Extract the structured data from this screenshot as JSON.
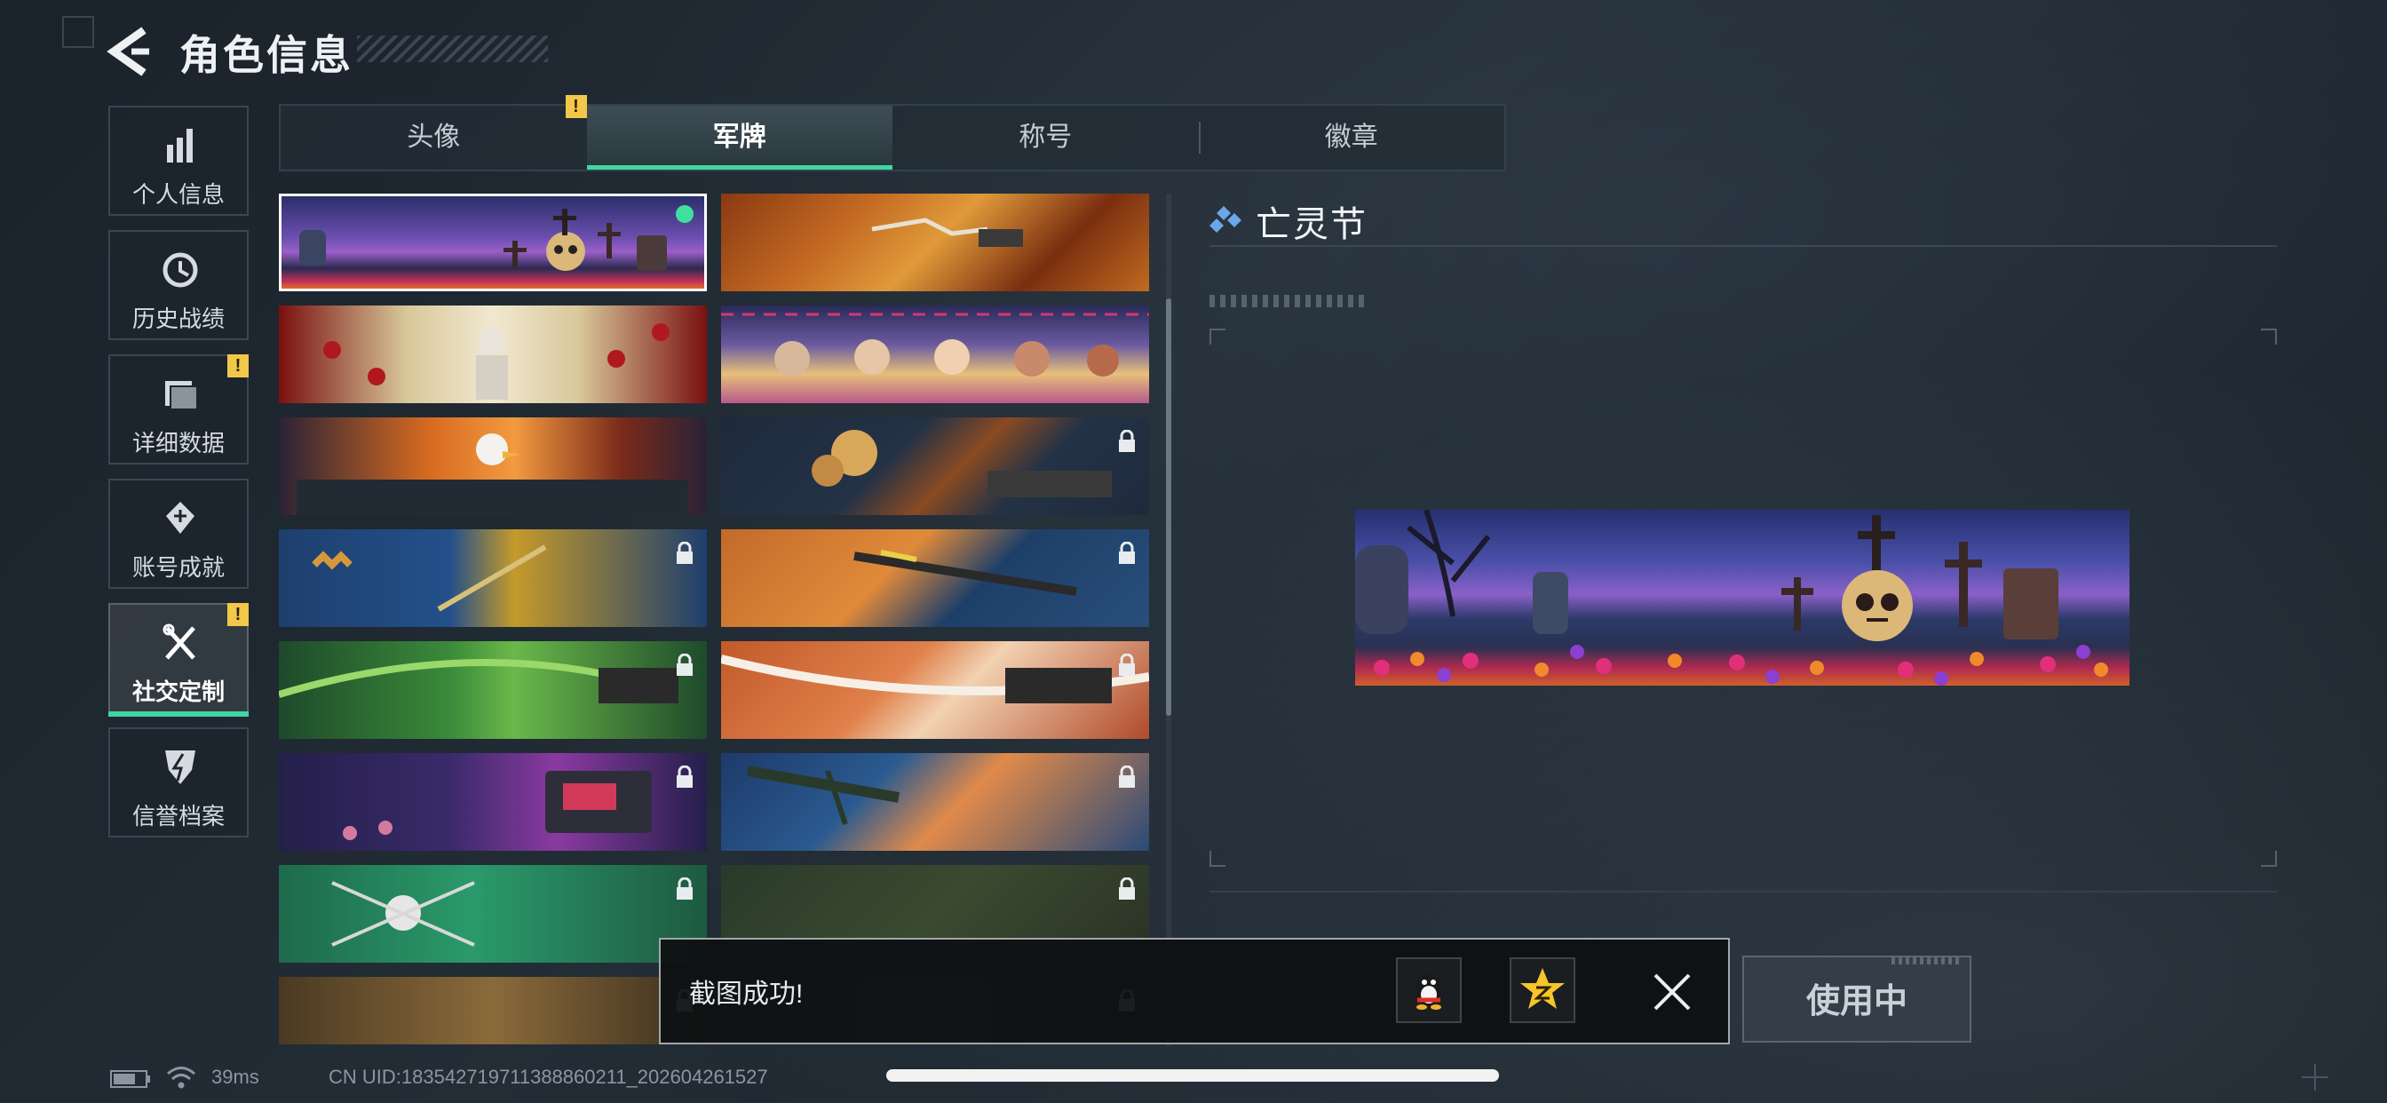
{
  "header": {
    "title": "角色信息"
  },
  "sidebar": {
    "items": [
      {
        "label": "个人信息",
        "icon": "bar-chart-icon"
      },
      {
        "label": "历史战绩",
        "icon": "history-clock-icon"
      },
      {
        "label": "详细数据",
        "icon": "folder-icon",
        "badge": "!"
      },
      {
        "label": "账号成就",
        "icon": "achievement-icon"
      },
      {
        "label": "社交定制",
        "icon": "tools-icon",
        "badge": "!",
        "active": true
      },
      {
        "label": "信誉档案",
        "icon": "reputation-icon"
      }
    ]
  },
  "tabs": [
    {
      "label": "头像",
      "badge": "!"
    },
    {
      "label": "军牌",
      "active": true
    },
    {
      "label": "称号"
    },
    {
      "label": "徽章"
    }
  ],
  "detail": {
    "title": "亡灵节",
    "use_label": "使用中"
  },
  "toast": {
    "text": "截图成功!",
    "share_targets": [
      "qq-icon",
      "qzone-icon"
    ]
  },
  "status": {
    "ping": "39ms",
    "uid": "CN UID:18354271971138886​0211_202604261527"
  },
  "colors": {
    "accent": "#3fd6a3",
    "badge": "#f2c84a",
    "selected_dot": "#3fe09e"
  }
}
